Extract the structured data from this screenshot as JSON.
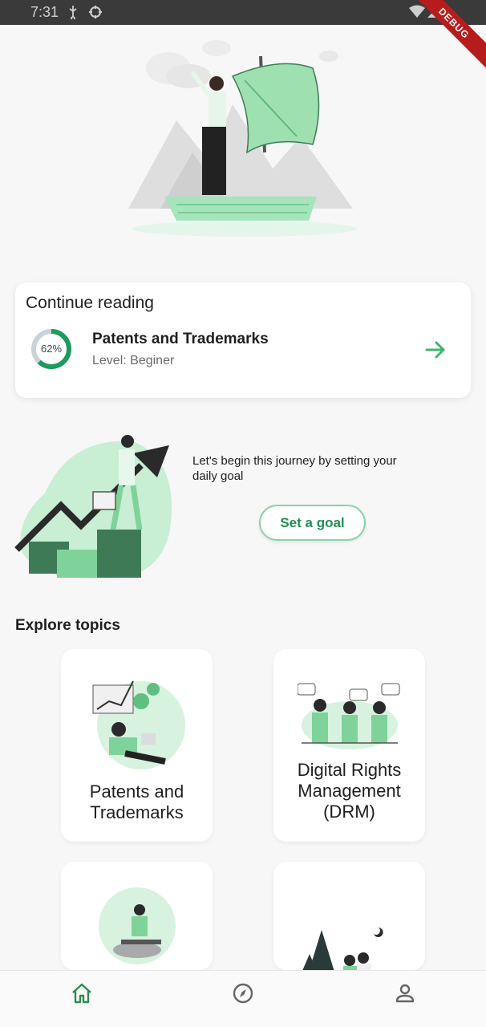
{
  "status_bar": {
    "time": "7:31",
    "debug_label": "DEBUG"
  },
  "continue_reading": {
    "heading": "Continue reading",
    "progress_label": "62%",
    "progress": 0.62,
    "course_title": "Patents and Trademarks",
    "level": "Level: Beginer"
  },
  "goal": {
    "text": "Let's begin this journey by setting your daily goal",
    "button_label": "Set a goal"
  },
  "explore": {
    "heading": "Explore topics",
    "topics": [
      {
        "title": "Patents and Trademarks"
      },
      {
        "title": "Digital Rights Management (DRM)"
      },
      {
        "title": ""
      },
      {
        "title": ""
      }
    ]
  },
  "nav": {
    "items": [
      "home-icon",
      "compass-icon",
      "person-icon"
    ],
    "active": "home-icon"
  },
  "colors": {
    "accent": "#1f8f54",
    "light_green": "#8ad3a8",
    "progress": "#1d9a5c",
    "progress_track": "#c9d1d9"
  }
}
